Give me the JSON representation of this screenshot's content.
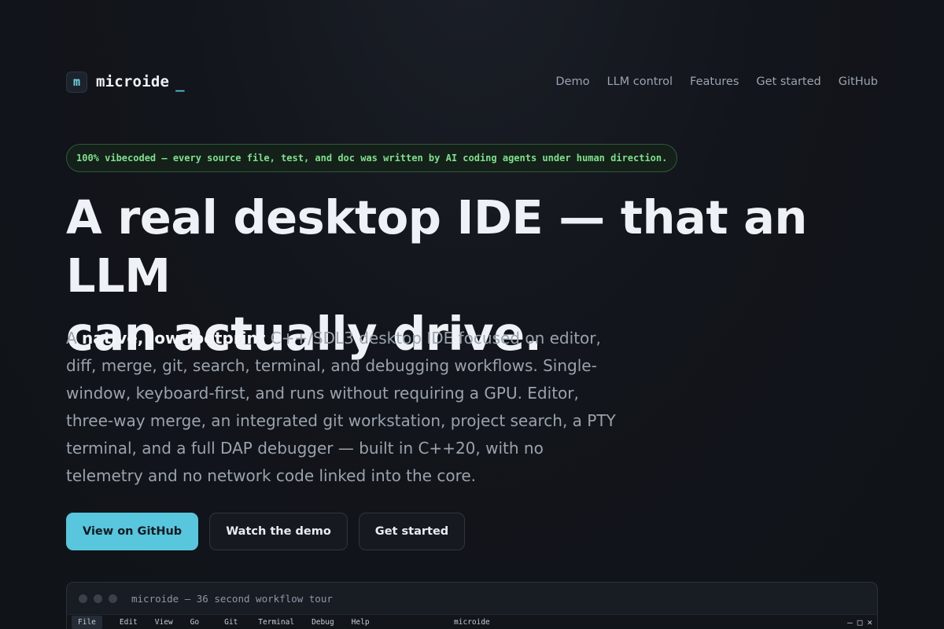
{
  "header": {
    "logo_glyph": "m",
    "brand": "microide",
    "cursor": "_",
    "nav": [
      "Demo",
      "LLM control",
      "Features",
      "Get started",
      "GitHub"
    ]
  },
  "badge": "100% vibecoded — every source file, test, and doc was written by AI coding agents under human direction.",
  "headline": {
    "line1": "A real desktop IDE — that an LLM",
    "line2": "can actually drive."
  },
  "lede": {
    "pre": "A ",
    "strong": "native, low-footprint",
    "rest": " C++/SDL3 desktop IDE focused on editor, diff, merge, git, search, terminal, and debugging workflows. Single-window, keyboard-first, and runs without requiring a GPU. Editor, three-way merge, an integrated git workstation, project search, a PTY terminal, and a full DAP debugger — built in C++20, with no telemetry and no network code linked into the core."
  },
  "buttons": {
    "github": "View on GitHub",
    "demo": "Watch the demo",
    "start": "Get started"
  },
  "window": {
    "title": "microide — 36 second workflow tour",
    "menus": [
      "File",
      "Edit",
      "View",
      "Go",
      "Git",
      "Terminal",
      "Debug",
      "Help"
    ],
    "app_title": "microide",
    "controls": {
      "minimize": "—",
      "maximize": "□",
      "close": "✕"
    }
  },
  "colors": {
    "accent": "#58c6dc",
    "badge_text": "#7ee08d",
    "background": "#12151b"
  }
}
